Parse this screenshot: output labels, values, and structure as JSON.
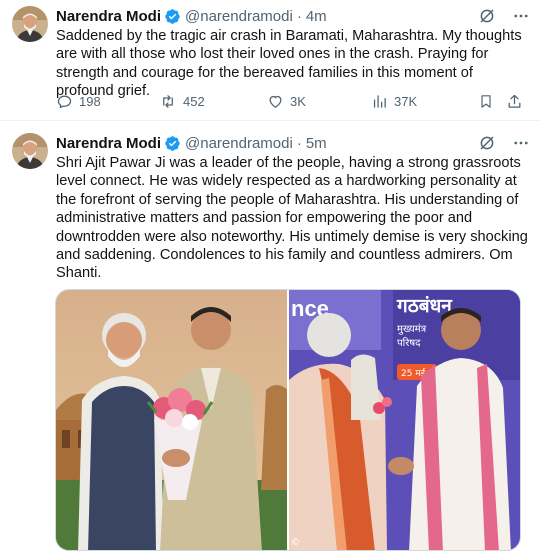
{
  "tweets": [
    {
      "name": "Narendra Modi",
      "handle": "@narendramodi",
      "separator": "·",
      "time": "4m",
      "text": "Saddened by the tragic air crash in Baramati, Maharashtra. My thoughts are with all those who lost their loved ones in the crash. Praying for strength and courage for the bereaved families in this moment of profound grief.",
      "stats": {
        "replies": "198",
        "reposts": "452",
        "likes": "3K",
        "views": "37K"
      }
    },
    {
      "name": "Narendra Modi",
      "handle": "@narendramodi",
      "separator": "·",
      "time": "5m",
      "text": "Shri Ajit Pawar Ji was a leader of the people, having a strong grassroots level connect. He was widely respected as a hardworking personality at the forefront of serving the people of Maharashtra. His understanding of administrative matters and passion for empowering the poor and downtrodden were also noteworthy. His untimely demise is very shocking and saddening. Condolences to his family and countless admirers. Om Shanti.",
      "media": {
        "banner_left": "nce",
        "banner_right": "गठबंधन",
        "banner_sub1": "मुख्यमंत्र",
        "banner_sub2": "परिषद",
        "banner_date": "25 मई",
        "watermark": "©"
      }
    }
  ],
  "colors": {
    "verified": "#1d9bf0",
    "muted": "#536471",
    "divider": "#eff3f4"
  },
  "icons": [
    "verified-badge-icon",
    "grok-icon",
    "more-icon",
    "reply-icon",
    "repost-icon",
    "like-icon",
    "views-icon",
    "bookmark-icon",
    "share-icon"
  ]
}
